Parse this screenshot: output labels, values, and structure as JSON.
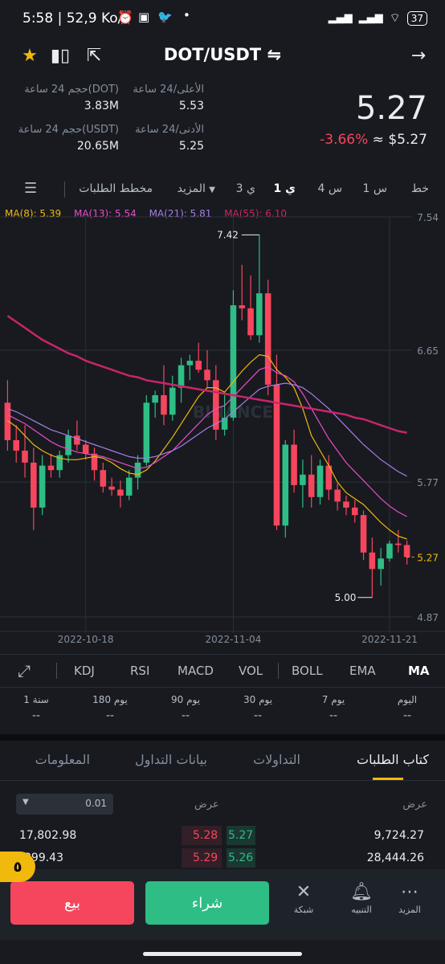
{
  "status": {
    "time": "5:58 | 52,9 Ko/s",
    "battery": "37"
  },
  "header": {
    "pair": "DOT/USDT",
    "swap_icon": "⇋"
  },
  "price": {
    "last": "5.27",
    "change": "-3.66%",
    "usd": "≈ $5.27"
  },
  "stats": {
    "high_label": "الأعلى/24 ساعة",
    "high": "5.53",
    "vol_dot_label": "حجم 24 ساعة(DOT)",
    "vol_dot": "3.83M",
    "low_label": "الأدنى/24 ساعة",
    "low": "5.25",
    "vol_usdt_label": "حجم 24 ساعة(USDT)",
    "vol_usdt": "20.65M"
  },
  "timeframes": [
    "خط",
    "1 س",
    "4 س",
    "1 ي",
    "3 ي",
    "المزيد",
    "مخطط الطلبات"
  ],
  "active_timeframe": "1 ي",
  "ma_legend": [
    {
      "label": "MA(8): 5.39",
      "color": "#f0b90b"
    },
    {
      "label": "MA(13): 5.54",
      "color": "#e84dc8"
    },
    {
      "label": "MA(21): 5.81",
      "color": "#a77ee6"
    },
    {
      "label": "MA(55): 6.10",
      "color": "#c9256b"
    }
  ],
  "chart_data": {
    "type": "candlestick",
    "y_ticks": [
      "7.54",
      "6.65",
      "5.77",
      "4.87"
    ],
    "x_ticks": [
      "2022-10-18",
      "2022-11-04",
      "2022-11-21"
    ],
    "current_price_label": "5.27",
    "high_marker": "7.42",
    "low_marker": "5.00",
    "watermark": "BINANCE",
    "ylim": [
      4.87,
      7.54
    ],
    "colors": {
      "up": "#2ebd85",
      "down": "#f6465d"
    },
    "candles": [
      [
        6.3,
        6.45,
        5.98,
        6.05
      ],
      [
        6.05,
        6.15,
        5.9,
        5.98
      ],
      [
        5.98,
        6.15,
        5.8,
        5.9
      ],
      [
        5.9,
        6.0,
        5.45,
        5.6
      ],
      [
        5.6,
        5.95,
        5.55,
        5.88
      ],
      [
        5.88,
        5.96,
        5.8,
        5.85
      ],
      [
        5.85,
        5.98,
        5.8,
        5.95
      ],
      [
        5.95,
        6.12,
        5.9,
        6.08
      ],
      [
        6.08,
        6.18,
        5.98,
        6.02
      ],
      [
        6.02,
        6.05,
        5.92,
        5.96
      ],
      [
        5.96,
        6.0,
        5.78,
        5.85
      ],
      [
        5.85,
        5.9,
        5.7,
        5.74
      ],
      [
        5.74,
        5.8,
        5.68,
        5.72
      ],
      [
        5.72,
        5.78,
        5.6,
        5.68
      ],
      [
        5.68,
        5.85,
        5.65,
        5.8
      ],
      [
        5.8,
        5.95,
        5.72,
        5.9
      ],
      [
        5.9,
        6.35,
        5.88,
        6.3
      ],
      [
        6.3,
        6.38,
        6.2,
        6.35
      ],
      [
        6.35,
        6.55,
        6.15,
        6.22
      ],
      [
        6.22,
        6.48,
        6.18,
        6.4
      ],
      [
        6.4,
        6.6,
        6.3,
        6.55
      ],
      [
        6.55,
        6.62,
        6.45,
        6.58
      ],
      [
        6.58,
        6.7,
        6.5,
        6.52
      ],
      [
        6.52,
        6.65,
        6.4,
        6.45
      ],
      [
        6.45,
        6.55,
        6.05,
        6.12
      ],
      [
        6.12,
        6.35,
        6.08,
        6.2
      ],
      [
        6.2,
        7.05,
        6.18,
        6.95
      ],
      [
        6.95,
        7.22,
        6.85,
        6.93
      ],
      [
        6.93,
        7.15,
        6.72,
        6.75
      ],
      [
        6.75,
        7.42,
        6.7,
        7.03
      ],
      [
        7.03,
        7.12,
        6.35,
        6.42
      ],
      [
        6.42,
        6.62,
        5.45,
        5.48
      ],
      [
        5.48,
        6.05,
        5.4,
        6.02
      ],
      [
        6.02,
        6.12,
        5.7,
        5.75
      ],
      [
        5.75,
        5.92,
        5.6,
        5.82
      ],
      [
        5.82,
        5.95,
        5.6,
        5.67
      ],
      [
        5.67,
        5.92,
        5.62,
        5.88
      ],
      [
        5.88,
        5.95,
        5.65,
        5.72
      ],
      [
        5.72,
        5.76,
        5.58,
        5.64
      ],
      [
        5.64,
        5.68,
        5.55,
        5.6
      ],
      [
        5.6,
        5.65,
        5.5,
        5.55
      ],
      [
        5.55,
        5.58,
        5.25,
        5.3
      ],
      [
        5.3,
        5.4,
        5.0,
        5.19
      ],
      [
        5.19,
        5.33,
        5.08,
        5.26
      ],
      [
        5.26,
        5.38,
        5.24,
        5.36
      ],
      [
        5.36,
        5.45,
        5.3,
        5.35
      ],
      [
        5.35,
        5.38,
        5.22,
        5.27
      ]
    ],
    "ma_lines": [
      {
        "name": "MA(8)",
        "color": "#f0b90b",
        "values": [
          6.18,
          6.14,
          6.08,
          6.02,
          5.98,
          5.95,
          5.93,
          5.92,
          5.92,
          5.93,
          5.94,
          5.93,
          5.9,
          5.86,
          5.83,
          5.82,
          5.85,
          5.91,
          5.99,
          6.07,
          6.16,
          6.25,
          6.34,
          6.4,
          6.4,
          6.37,
          6.44,
          6.51,
          6.57,
          6.62,
          6.61,
          6.52,
          6.47,
          6.4,
          6.26,
          6.08,
          5.98,
          5.88,
          5.77,
          5.7,
          5.66,
          5.62,
          5.56,
          5.5,
          5.45,
          5.41,
          5.39
        ]
      },
      {
        "name": "MA(13)",
        "color": "#e84dc8",
        "values": [
          6.22,
          6.19,
          6.16,
          6.12,
          6.08,
          6.04,
          6.01,
          5.99,
          5.97,
          5.96,
          5.95,
          5.94,
          5.92,
          5.9,
          5.88,
          5.86,
          5.87,
          5.9,
          5.94,
          5.98,
          6.04,
          6.1,
          6.16,
          6.22,
          6.26,
          6.28,
          6.34,
          6.4,
          6.46,
          6.52,
          6.54,
          6.5,
          6.48,
          6.44,
          6.36,
          6.26,
          6.16,
          6.06,
          5.98,
          5.9,
          5.84,
          5.78,
          5.72,
          5.66,
          5.61,
          5.57,
          5.54
        ]
      },
      {
        "name": "MA(21)",
        "color": "#a77ee6",
        "values": [
          6.26,
          6.24,
          6.21,
          6.18,
          6.15,
          6.12,
          6.1,
          6.08,
          6.06,
          6.04,
          6.02,
          6.0,
          5.98,
          5.96,
          5.94,
          5.93,
          5.93,
          5.94,
          5.96,
          5.98,
          6.01,
          6.05,
          6.09,
          6.13,
          6.16,
          6.19,
          6.24,
          6.29,
          6.34,
          6.39,
          6.41,
          6.42,
          6.43,
          6.42,
          6.4,
          6.36,
          6.31,
          6.26,
          6.2,
          6.14,
          6.08,
          6.02,
          5.97,
          5.92,
          5.88,
          5.84,
          5.81
        ]
      },
      {
        "name": "MA(55)",
        "color": "#c9256b",
        "values": [
          6.88,
          6.84,
          6.8,
          6.76,
          6.72,
          6.69,
          6.66,
          6.63,
          6.61,
          6.58,
          6.56,
          6.54,
          6.52,
          6.5,
          6.48,
          6.47,
          6.45,
          6.44,
          6.43,
          6.42,
          6.41,
          6.4,
          6.39,
          6.38,
          6.37,
          6.36,
          6.35,
          6.34,
          6.33,
          6.32,
          6.31,
          6.3,
          6.29,
          6.28,
          6.27,
          6.26,
          6.25,
          6.24,
          6.23,
          6.22,
          6.2,
          6.19,
          6.17,
          6.15,
          6.13,
          6.11,
          6.1
        ]
      }
    ]
  },
  "indicators": [
    "KDJ",
    "RSI",
    "MACD",
    "VOL",
    "BOLL",
    "EMA",
    "MA"
  ],
  "active_indicator": "MA",
  "performance": [
    {
      "label": "اليوم",
      "value": "--"
    },
    {
      "label": "7 يوم",
      "value": "--"
    },
    {
      "label": "30 يوم",
      "value": "--"
    },
    {
      "label": "90 يوم",
      "value": "--"
    },
    {
      "label": "180 يوم",
      "value": "--"
    },
    {
      "label": "1 سنة",
      "value": "--"
    }
  ],
  "tabs": [
    "كتاب الطلبات",
    "التداولات",
    "بيانات التداول",
    "المعلومات"
  ],
  "active_tab": "كتاب الطلبات",
  "orderbook": {
    "bid_header": "عرض",
    "ask_header": "عرض",
    "depth": "0.01",
    "rows": [
      {
        "bid_qty": "9,724.27",
        "bid_price": "5.27",
        "ask_price": "5.28",
        "ask_qty": "17,802.98"
      },
      {
        "bid_qty": "28,444.26",
        "bid_price": "5.26",
        "ask_price": "5.29",
        "ask_qty": "899.43"
      }
    ]
  },
  "actions": {
    "buy": "شراء",
    "sell": "بيع"
  },
  "nav": [
    {
      "label": "المزيد",
      "icon": "more-icon"
    },
    {
      "label": "التنبيه",
      "icon": "bell-icon"
    },
    {
      "label": "شبكة",
      "icon": "grid-bot-icon"
    }
  ],
  "badge": "٥"
}
